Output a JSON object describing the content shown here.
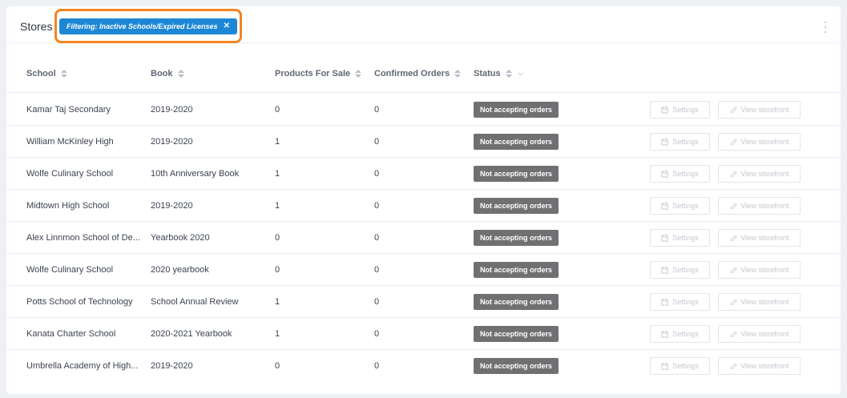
{
  "header": {
    "title": "Stores",
    "filter_label": "Filtering: Inactive Schools/Expired Licenses",
    "filter_close": "✕"
  },
  "columns": {
    "school": "School",
    "book": "Book",
    "products": "Products For Sale",
    "orders": "Confirmed Orders",
    "status": "Status"
  },
  "rows": [
    {
      "school": "Kamar Taj Secondary",
      "book": "2019-2020",
      "products": "0",
      "orders": "0",
      "status": "Not accepting orders",
      "settings": "Settings",
      "view": "View storefront"
    },
    {
      "school": "William McKinley High",
      "book": "2019-2020",
      "products": "1",
      "orders": "0",
      "status": "Not accepting orders",
      "settings": "Settings",
      "view": "View storefront"
    },
    {
      "school": "Wolfe Culinary School",
      "book": "10th Anniversary Book",
      "products": "1",
      "orders": "0",
      "status": "Not accepting orders",
      "settings": "Settings",
      "view": "View storefront"
    },
    {
      "school": "Midtown High School",
      "book": "2019-2020",
      "products": "1",
      "orders": "0",
      "status": "Not accepting orders",
      "settings": "Settings",
      "view": "View storefront"
    },
    {
      "school": "Alex Linnmon School of De...",
      "book": "Yearbook 2020",
      "products": "0",
      "orders": "0",
      "status": "Not accepting orders",
      "settings": "Settings",
      "view": "View storefront"
    },
    {
      "school": "Wolfe Culinary School",
      "book": "2020 yearbook",
      "products": "0",
      "orders": "0",
      "status": "Not accepting orders",
      "settings": "Settings",
      "view": "View storefront"
    },
    {
      "school": "Potts School of Technology",
      "book": "School Annual Review",
      "products": "1",
      "orders": "0",
      "status": "Not accepting orders",
      "settings": "Settings",
      "view": "View storefront"
    },
    {
      "school": "Kanata Charter School",
      "book": "2020-2021 Yearbook",
      "products": "1",
      "orders": "0",
      "status": "Not accepting orders",
      "settings": "Settings",
      "view": "View storefront"
    },
    {
      "school": "Umbrella Academy of High...",
      "book": "2019-2020",
      "products": "0",
      "orders": "0",
      "status": "Not accepting orders",
      "settings": "Settings",
      "view": "View storefront"
    }
  ],
  "colors": {
    "accent": "#1d87d6",
    "highlight": "#f2851f",
    "status_badge": "#6f7072"
  }
}
